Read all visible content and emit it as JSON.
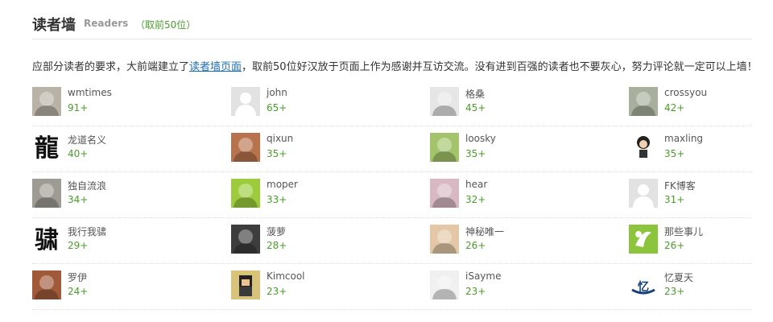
{
  "header": {
    "title": "读者墙",
    "subtitle": "Readers",
    "note": "（取前50位）"
  },
  "intro": {
    "before": "应部分读者的要求，大前端建立了",
    "link": "读者墙页面",
    "after": "，取前50位好汉放于页面上作为感谢并互访交流。没有进到百强的读者也不要灰心，努力评论就一定可以上墙！"
  },
  "readers": [
    {
      "name": "wmtimes",
      "count": "91+",
      "avatar": "rabbit-photo",
      "color": "#b9b2a6"
    },
    {
      "name": "john",
      "count": "65+",
      "avatar": "default-avatar",
      "color": "#d9d9d9"
    },
    {
      "name": "格桑",
      "count": "45+",
      "avatar": "anime-face",
      "color": "#e6e6e6"
    },
    {
      "name": "crossyou",
      "count": "42+",
      "avatar": "man-photo",
      "color": "#a7b09d"
    },
    {
      "name": "龙道名义",
      "count": "40+",
      "avatar": "calligraphy-long",
      "color": "#ffffff"
    },
    {
      "name": "qixun",
      "count": "35+",
      "avatar": "muscle-photo",
      "color": "#b8734d"
    },
    {
      "name": "loosky",
      "count": "35+",
      "avatar": "glasses-cartoon",
      "color": "#a3c46a"
    },
    {
      "name": "maxling",
      "count": "35+",
      "avatar": "chibi-figure",
      "color": "#ffffff"
    },
    {
      "name": "独自流浪",
      "count": "34+",
      "avatar": "hamster-photo",
      "color": "#9e9b94"
    },
    {
      "name": "moper",
      "count": "33+",
      "avatar": "green-cartoon",
      "color": "#9ccc3b"
    },
    {
      "name": "hear",
      "count": "32+",
      "avatar": "doll-photo",
      "color": "#d8b8c3"
    },
    {
      "name": "FK博客",
      "count": "31+",
      "avatar": "default-avatar",
      "color": "#d9d9d9"
    },
    {
      "name": "我行我骕",
      "count": "29+",
      "avatar": "calligraphy-su",
      "color": "#ffffff"
    },
    {
      "name": "菠萝",
      "count": "28+",
      "avatar": "sunglasses-photo",
      "color": "#3d3d3d"
    },
    {
      "name": "神秘唯一",
      "count": "26+",
      "avatar": "blond-photo",
      "color": "#e3c7a7"
    },
    {
      "name": "那些事儿",
      "count": "26+",
      "avatar": "green-logo",
      "color": "#8cc43b"
    },
    {
      "name": "罗伊",
      "count": "24+",
      "avatar": "basketball-photo",
      "color": "#a05a3a"
    },
    {
      "name": "Kimcool",
      "count": "23+",
      "avatar": "pixel-character",
      "color": "#d9c27a"
    },
    {
      "name": "iSayme",
      "count": "23+",
      "avatar": "anime-boy",
      "color": "#f0f0f0"
    },
    {
      "name": "忆夏天",
      "count": "23+",
      "avatar": "blue-logo",
      "color": "#ffffff"
    }
  ]
}
